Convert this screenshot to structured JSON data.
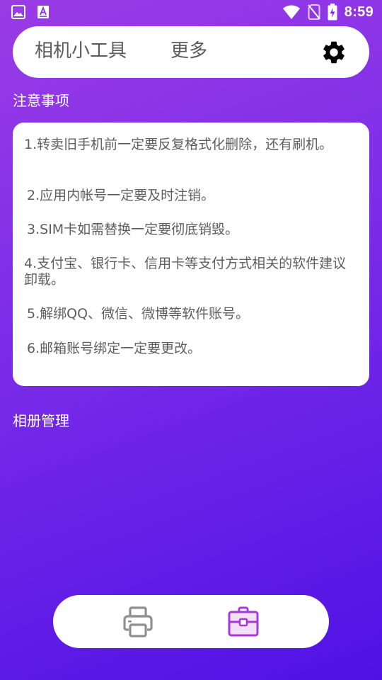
{
  "status_bar": {
    "time": "8:59",
    "left_icons": [
      "image-icon",
      "a-letter-icon"
    ],
    "right_icons": [
      "wifi-icon",
      "no-sim-icon",
      "battery-charging-icon"
    ]
  },
  "top_bar": {
    "tabs": [
      {
        "label": "相机小工具"
      },
      {
        "label": "更多"
      }
    ],
    "settings_icon": "gear-icon"
  },
  "notes": {
    "title": "注意事项",
    "items": [
      {
        "text": "1.转卖旧手机前一定要反复格式化删除，还有刷机。"
      },
      {
        "text": "2.应用内帐号一定要及时注销。"
      },
      {
        "text": "3.SIM卡如需替换一定要彻底销毁。"
      },
      {
        "text": "4.支付宝、银行卡、信用卡等支付方式相关的软件建议卸载。"
      },
      {
        "text": "5.解绑QQ、微信、微博等软件账号。"
      },
      {
        "text": "6.邮箱账号绑定一定要更改。"
      }
    ]
  },
  "album": {
    "title": "相册管理"
  },
  "bottom_nav": {
    "items": [
      {
        "icon": "printer-icon",
        "active": false
      },
      {
        "icon": "toolbox-icon",
        "active": true
      }
    ]
  },
  "colors": {
    "background_start": "#9a3ce6",
    "background_end": "#4f12e6",
    "card": "#ffffff",
    "tab_text": "#5b5b5b",
    "note_text": "#5e5e5e",
    "nav_inactive": "#8f8f8f",
    "nav_active": "#a63ad6"
  }
}
